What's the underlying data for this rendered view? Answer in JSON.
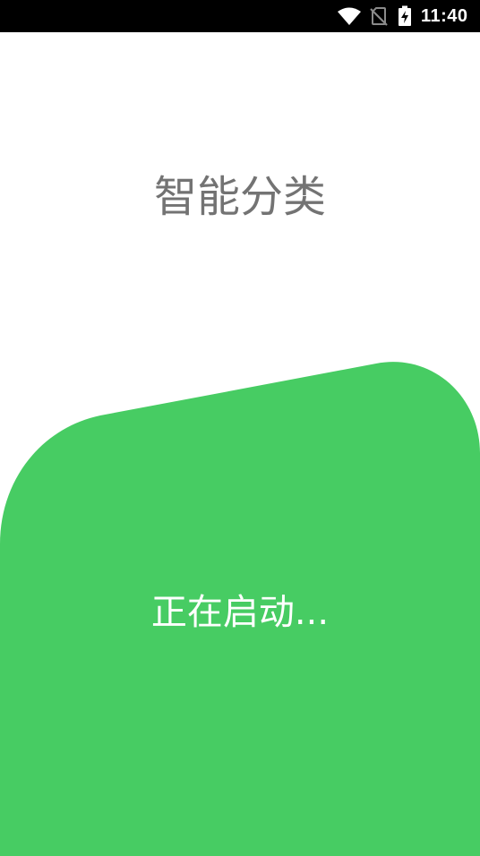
{
  "status_bar": {
    "time": "11:40",
    "icons": [
      "wifi-icon",
      "no-sim-icon",
      "battery-charging-icon"
    ],
    "background": "#000000",
    "foreground": "#ffffff"
  },
  "splash": {
    "title": "智能分类",
    "loading_text": "正在启动..."
  },
  "colors": {
    "background": "#ffffff",
    "accent_green": "#47CC63",
    "title_gray": "#737373",
    "loading_text": "#ffffff"
  }
}
